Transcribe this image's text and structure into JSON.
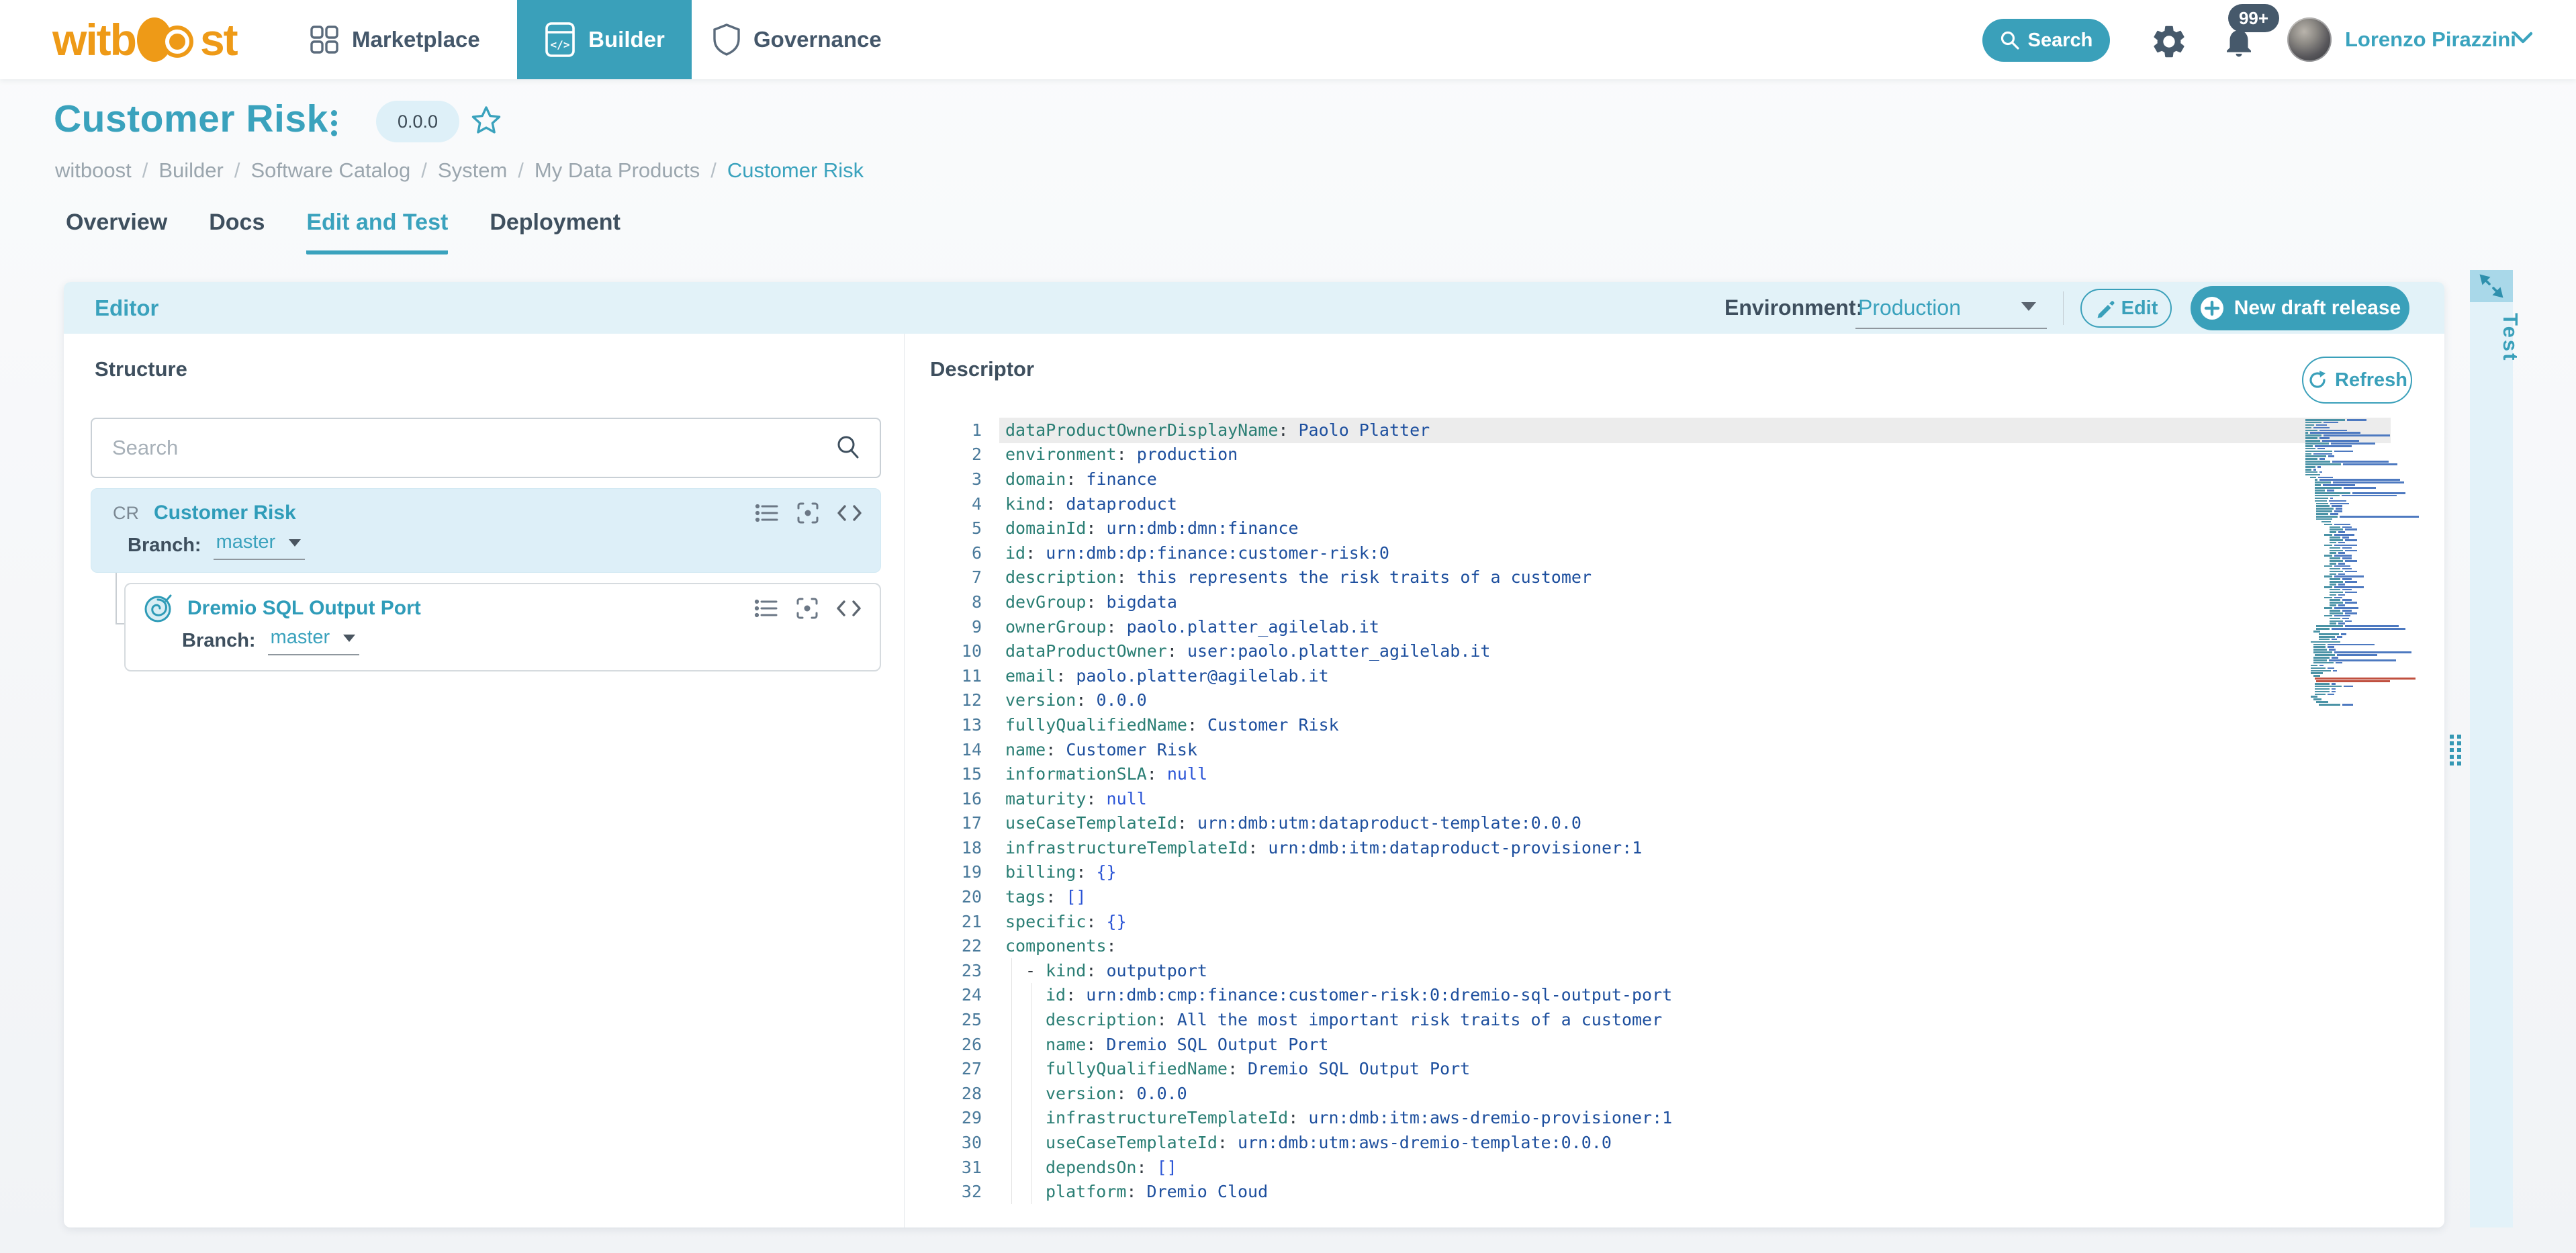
{
  "nav": {
    "logo_text_left": "witb",
    "logo_text_right": "st",
    "items": [
      {
        "label": "Marketplace",
        "active": false
      },
      {
        "label": "Builder",
        "active": true
      },
      {
        "label": "Governance",
        "active": false
      }
    ],
    "search_label": "Search",
    "notification_badge": "99+",
    "user_name": "Lorenzo Pirazzini"
  },
  "page": {
    "title": "Customer Risk",
    "version_badge": "0.0.0",
    "breadcrumb": [
      "witboost",
      "Builder",
      "Software Catalog",
      "System",
      "My Data Products",
      "Customer Risk"
    ],
    "tabs": [
      "Overview",
      "Docs",
      "Edit and Test",
      "Deployment"
    ],
    "active_tab": "Edit and Test"
  },
  "editor": {
    "title": "Editor",
    "environment_label": "Environment:",
    "environment_value": "Production",
    "edit_button": "Edit",
    "new_draft_button": "New draft release",
    "test_tab": "Test"
  },
  "structure": {
    "title": "Structure",
    "search_placeholder": "Search",
    "nodes": [
      {
        "badge": "CR",
        "name": "Customer Risk",
        "branch_label": "Branch:",
        "branch": "master"
      },
      {
        "icon": "dremio-icon",
        "name": "Dremio SQL Output Port",
        "branch_label": "Branch:",
        "branch": "master"
      }
    ]
  },
  "descriptor": {
    "title": "Descriptor",
    "refresh_button": "Refresh",
    "current_line": 1,
    "lines": [
      {
        "n": 1,
        "indent": 0,
        "key": "dataProductOwnerDisplayName",
        "value": "Paolo Platter",
        "t": "v"
      },
      {
        "n": 2,
        "indent": 0,
        "key": "environment",
        "value": "production",
        "t": "v"
      },
      {
        "n": 3,
        "indent": 0,
        "key": "domain",
        "value": "finance",
        "t": "v"
      },
      {
        "n": 4,
        "indent": 0,
        "key": "kind",
        "value": "dataproduct",
        "t": "v"
      },
      {
        "n": 5,
        "indent": 0,
        "key": "domainId",
        "value": "urn:dmb:dmn:finance",
        "t": "v"
      },
      {
        "n": 6,
        "indent": 0,
        "key": "id",
        "value": "urn:dmb:dp:finance:customer-risk:0",
        "t": "v"
      },
      {
        "n": 7,
        "indent": 0,
        "key": "description",
        "value": "this represents the risk traits of a customer",
        "t": "v"
      },
      {
        "n": 8,
        "indent": 0,
        "key": "devGroup",
        "value": "bigdata",
        "t": "v"
      },
      {
        "n": 9,
        "indent": 0,
        "key": "ownerGroup",
        "value": "paolo.platter_agilelab.it",
        "t": "v"
      },
      {
        "n": 10,
        "indent": 0,
        "key": "dataProductOwner",
        "value": "user:paolo.platter_agilelab.it",
        "t": "v"
      },
      {
        "n": 11,
        "indent": 0,
        "key": "email",
        "value": "paolo.platter@agilelab.it",
        "t": "v"
      },
      {
        "n": 12,
        "indent": 0,
        "key": "version",
        "value": "0.0.0",
        "t": "v"
      },
      {
        "n": 13,
        "indent": 0,
        "key": "fullyQualifiedName",
        "value": "Customer Risk",
        "t": "v"
      },
      {
        "n": 14,
        "indent": 0,
        "key": "name",
        "value": "Customer Risk",
        "t": "v"
      },
      {
        "n": 15,
        "indent": 0,
        "key": "informationSLA",
        "value": "null",
        "t": "s"
      },
      {
        "n": 16,
        "indent": 0,
        "key": "maturity",
        "value": "null",
        "t": "s"
      },
      {
        "n": 17,
        "indent": 0,
        "key": "useCaseTemplateId",
        "value": "urn:dmb:utm:dataproduct-template:0.0.0",
        "t": "v"
      },
      {
        "n": 18,
        "indent": 0,
        "key": "infrastructureTemplateId",
        "value": "urn:dmb:itm:dataproduct-provisioner:1",
        "t": "v"
      },
      {
        "n": 19,
        "indent": 0,
        "key": "billing",
        "value": "{}",
        "t": "s"
      },
      {
        "n": 20,
        "indent": 0,
        "key": "tags",
        "value": "[]",
        "t": "s"
      },
      {
        "n": 21,
        "indent": 0,
        "key": "specific",
        "value": "{}",
        "t": "s"
      },
      {
        "n": 22,
        "indent": 0,
        "key": "components",
        "value": "",
        "t": "v"
      },
      {
        "n": 23,
        "indent": 1,
        "dash": true,
        "key": "kind",
        "value": "outputport",
        "t": "v"
      },
      {
        "n": 24,
        "indent": 2,
        "key": "id",
        "value": "urn:dmb:cmp:finance:customer-risk:0:dremio-sql-output-port",
        "t": "v"
      },
      {
        "n": 25,
        "indent": 2,
        "key": "description",
        "value": "All the most important risk traits of a customer",
        "t": "v"
      },
      {
        "n": 26,
        "indent": 2,
        "key": "name",
        "value": "Dremio SQL Output Port",
        "t": "v"
      },
      {
        "n": 27,
        "indent": 2,
        "key": "fullyQualifiedName",
        "value": "Dremio SQL Output Port",
        "t": "v"
      },
      {
        "n": 28,
        "indent": 2,
        "key": "version",
        "value": "0.0.0",
        "t": "v"
      },
      {
        "n": 29,
        "indent": 2,
        "key": "infrastructureTemplateId",
        "value": "urn:dmb:itm:aws-dremio-provisioner:1",
        "t": "v"
      },
      {
        "n": 30,
        "indent": 2,
        "key": "useCaseTemplateId",
        "value": "urn:dmb:utm:aws-dremio-template:0.0.0",
        "t": "v"
      },
      {
        "n": 31,
        "indent": 2,
        "key": "dependsOn",
        "value": "[]",
        "t": "s"
      },
      {
        "n": 32,
        "indent": 2,
        "key": "platform",
        "value": "Dremio Cloud",
        "t": "v"
      }
    ]
  },
  "colors": {
    "accent_teal": "#3aa0ba",
    "brand_orange": "#ee9a17",
    "nav_slate": "#44576a",
    "header_blue": "#e2f2f8",
    "selected_card_blue": "#ddeff8",
    "yaml_key": "#2a7e74",
    "yaml_value": "#1d4f9e",
    "yaml_special": "#2b55d6",
    "line_number": "#4a7a9b",
    "minimap_red": "#c0503f"
  }
}
